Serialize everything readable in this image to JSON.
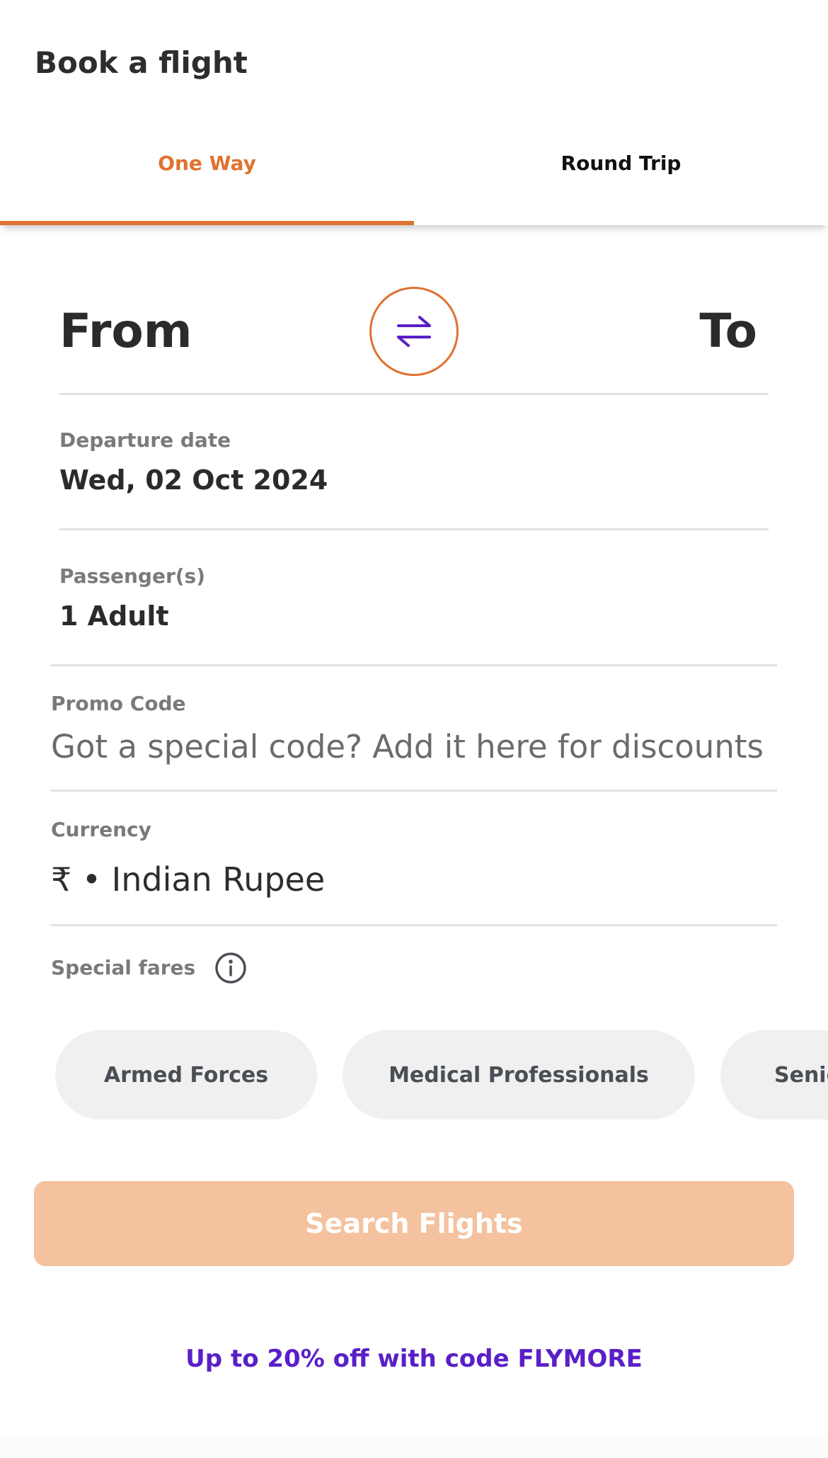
{
  "header": {
    "title": "Book a flight"
  },
  "tabs": [
    {
      "label": "One Way",
      "active": true
    },
    {
      "label": "Round Trip",
      "active": false
    }
  ],
  "route": {
    "from_label": "From",
    "to_label": "To",
    "swap_icon": "swap-arrows-icon"
  },
  "departure": {
    "label": "Departure date",
    "value": "Wed, 02 Oct 2024"
  },
  "passengers": {
    "label": "Passenger(s)",
    "value": "1 Adult"
  },
  "promo": {
    "label": "Promo Code",
    "placeholder": "Got a special code? Add it here for discounts"
  },
  "currency": {
    "label": "Currency",
    "value": "₹ • Indian Rupee"
  },
  "special_fares": {
    "label": "Special fares",
    "info_icon": "info-icon",
    "chips": [
      "Armed Forces",
      "Medical Professionals",
      "Senio"
    ]
  },
  "search": {
    "label": "Search Flights"
  },
  "banner": {
    "text": "Up to 20% off with code FLYMORE"
  },
  "colors": {
    "accent": "#e0722f",
    "swap_icon": "#5a1fc7",
    "search_disabled": "#f4c29e",
    "banner_text": "#5a1fc7"
  }
}
